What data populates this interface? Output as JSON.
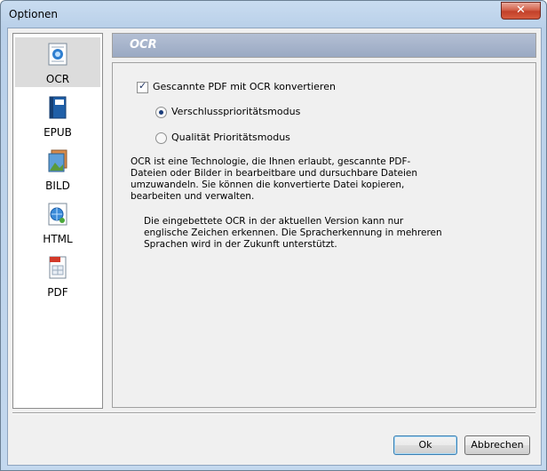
{
  "window": {
    "title": "Optionen",
    "close_label": "✕"
  },
  "sidebar": {
    "items": [
      {
        "label": "OCR",
        "icon": "ocr-icon",
        "selected": true
      },
      {
        "label": "EPUB",
        "icon": "epub-icon",
        "selected": false
      },
      {
        "label": "BILD",
        "icon": "image-icon",
        "selected": false
      },
      {
        "label": "HTML",
        "icon": "html-icon",
        "selected": false
      },
      {
        "label": "PDF",
        "icon": "pdf-icon",
        "selected": false
      }
    ]
  },
  "panel": {
    "header": "OCR",
    "checkbox_label": "Gescannte PDF mit OCR konvertieren",
    "checkbox_checked": true,
    "radio_1": "Verschlussprioritätsmodus",
    "radio_2": "Qualität Prioritätsmodus",
    "para_1": "OCR ist eine Technologie, die Ihnen erlaubt, gescannte PDF-Dateien oder Bilder in bearbeitbare und dursuchbare Dateien umzuwandeln. Sie können die konvertierte Datei kopieren, bearbeiten und verwalten.",
    "para_2": "Die eingebettete OCR in der aktuellen Version kann nur englische Zeichen erkennen. Die Spracherkennung in mehreren Sprachen wird in der Zukunft unterstützt."
  },
  "buttons": {
    "ok": "Ok",
    "cancel": "Abbrechen"
  },
  "colors": {
    "accent": "#1a3c7a",
    "header": "#9aa9c3",
    "close": "#c2412a"
  }
}
